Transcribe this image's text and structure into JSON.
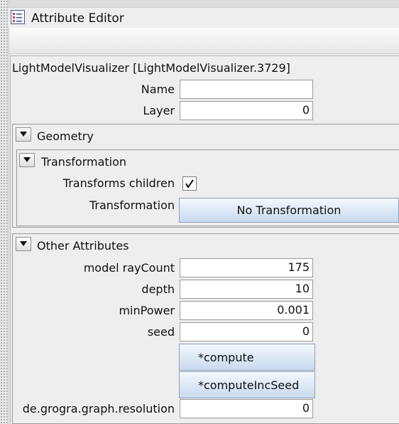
{
  "window": {
    "title": "Attribute Editor",
    "icon": "attribute-editor-icon"
  },
  "object": {
    "title": "LightModelVisualizer [LightModelVisualizer.3729]"
  },
  "general": {
    "name_label": "Name",
    "name_value": "",
    "layer_label": "Layer",
    "layer_value": "0"
  },
  "geometry": {
    "title": "Geometry",
    "transformation": {
      "title": "Transformation",
      "transforms_children_label": "Transforms children",
      "transforms_children_checked": true,
      "transformation_label": "Transformation",
      "transformation_button": "No Transformation"
    }
  },
  "other": {
    "title": "Other Attributes",
    "ray_count_label": "model rayCount",
    "ray_count_value": "175",
    "depth_label": "depth",
    "depth_value": "10",
    "min_power_label": "minPower",
    "min_power_value": "0.001",
    "seed_label": "seed",
    "seed_value": "0",
    "compute_button": "*compute",
    "compute_inc_seed_button": "*computeIncSeed",
    "resolution_label": "de.grogra.graph.resolution",
    "resolution_value": "0"
  },
  "colors": {
    "button_gradient_top": "#f3f8fd",
    "button_gradient_bottom": "#c9daee",
    "icon_accent": "#d04040"
  }
}
